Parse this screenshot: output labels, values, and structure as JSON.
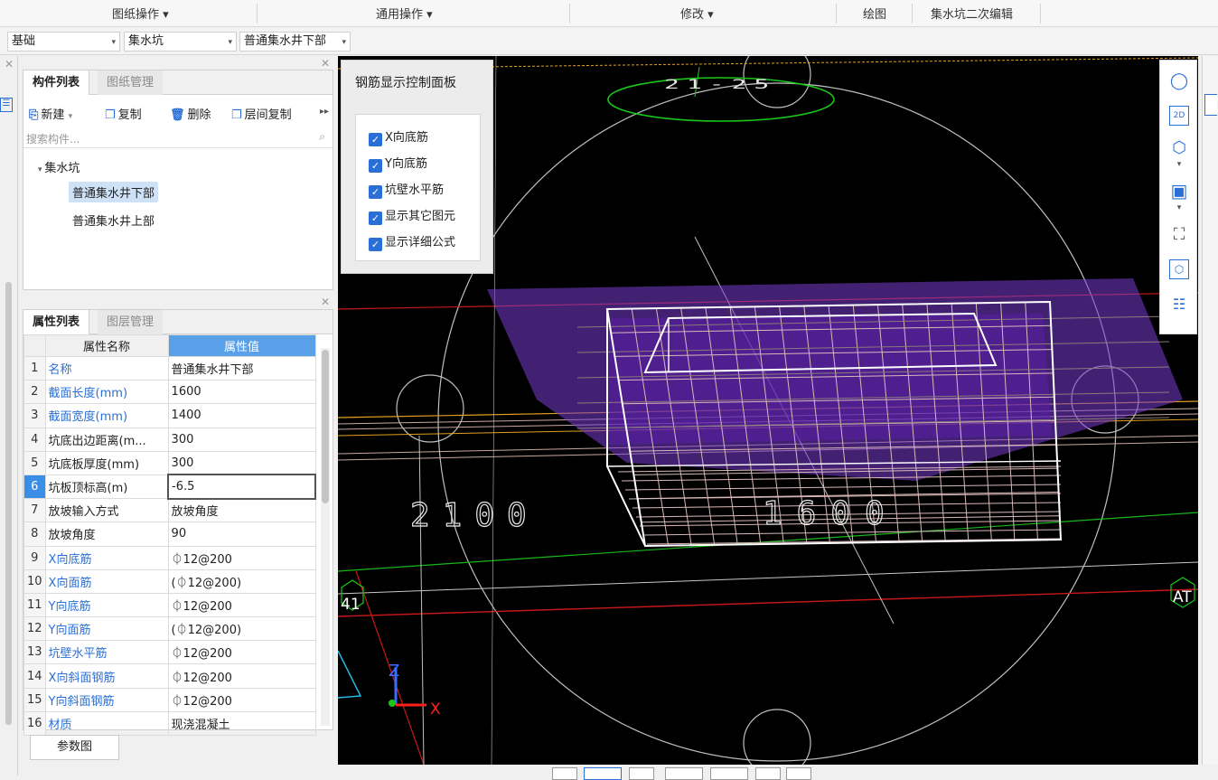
{
  "ribbon": {
    "drawing_ops": "图纸操作",
    "general_ops": "通用操作",
    "modify": "修改",
    "draw": "绘图",
    "sump_edit": "集水坑二次编辑"
  },
  "selectors": {
    "floor": "基础",
    "type": "集水坑",
    "component": "普通集水井下部"
  },
  "component_panel": {
    "tab_active": "构件列表",
    "tab_inactive": "图纸管理",
    "new": "新建",
    "copy": "复制",
    "delete": "删除",
    "floor_copy": "层间复制",
    "search_placeholder": "搜索构件...",
    "tree_root": "集水坑",
    "tree_items": [
      "普通集水井下部",
      "普通集水井上部"
    ]
  },
  "props_panel": {
    "tab_active": "属性列表",
    "tab_inactive": "图层管理",
    "col_name": "属性名称",
    "col_value": "属性值",
    "rows": [
      {
        "n": "1",
        "name": "名称",
        "value": "普通集水井下部",
        "blue": true
      },
      {
        "n": "2",
        "name": "截面长度(mm)",
        "value": "1600",
        "blue": true
      },
      {
        "n": "3",
        "name": "截面宽度(mm)",
        "value": "1400",
        "blue": true
      },
      {
        "n": "4",
        "name": "坑底出边距离(m...",
        "value": "300",
        "blue": false
      },
      {
        "n": "5",
        "name": "坑底板厚度(mm)",
        "value": "300",
        "blue": false
      },
      {
        "n": "6",
        "name": "坑板顶标高(m)",
        "value": "-6.5",
        "blue": false
      },
      {
        "n": "7",
        "name": "放坡输入方式",
        "value": "放坡角度",
        "blue": false
      },
      {
        "n": "8",
        "name": "放坡角度",
        "value": "90",
        "blue": false
      },
      {
        "n": "9",
        "name": "X向底筋",
        "value": "⏀12@200",
        "blue": true
      },
      {
        "n": "10",
        "name": "X向面筋",
        "value": "(⏀12@200)",
        "blue": true
      },
      {
        "n": "11",
        "name": "Y向底筋",
        "value": "⏀12@200",
        "blue": true
      },
      {
        "n": "12",
        "name": "Y向面筋",
        "value": "(⏀12@200)",
        "blue": true
      },
      {
        "n": "13",
        "name": "坑壁水平筋",
        "value": "⏀12@200",
        "blue": true
      },
      {
        "n": "14",
        "name": "X向斜面钢筋",
        "value": "⏀12@200",
        "blue": true
      },
      {
        "n": "15",
        "name": "Y向斜面钢筋",
        "value": "⏀12@200",
        "blue": true
      },
      {
        "n": "16",
        "name": "材质",
        "value": "现浇混凝土",
        "blue": true
      }
    ],
    "param_button": "参数图"
  },
  "control_panel": {
    "title": "钢筋显示控制面板",
    "options": [
      "X向底筋",
      "Y向底筋",
      "坑壁水平筋",
      "显示其它图元",
      "显示详细公式"
    ]
  },
  "viewport": {
    "label_top": "21-25",
    "dim1": "2100",
    "dim2": "1600",
    "label_left": "41",
    "label_right": "AT",
    "axis_z": "Z",
    "axis_x": "X",
    "colors": {
      "box": "#ffffff",
      "rebar": "#c8a8a0",
      "purple": "#7a3ccf",
      "green": "#19c819",
      "red": "#d01818",
      "orange": "#e0a020"
    }
  },
  "right_tools": {
    "mode_2d": "2D"
  }
}
